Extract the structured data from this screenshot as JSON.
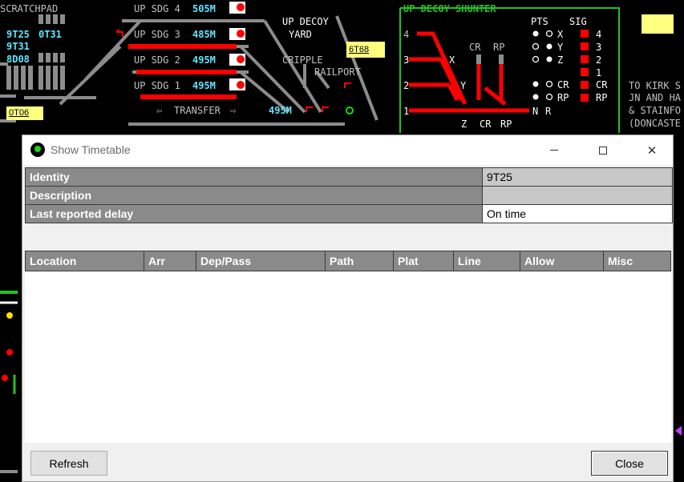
{
  "panel": {
    "scratchpad_label": "SCRATCHPAD",
    "scratch_entries": [
      "9T25",
      "0T31",
      "9T31",
      "8D08"
    ],
    "scratch_box": "0T06",
    "sidings": [
      {
        "label": "UP SDG 4",
        "length": "505M"
      },
      {
        "label": "UP SDG 3",
        "length": "485M"
      },
      {
        "label": "UP SDG 2",
        "length": "495M"
      },
      {
        "label": "UP SDG 1",
        "length": "495M"
      }
    ],
    "transfer_label": "TRANSFER",
    "transfer_length": "495M",
    "decoy_yard_line1": "UP DECOY",
    "decoy_yard_line2": "YARD",
    "cripple_label": "CRIPPLE",
    "railport_label": "RAILPORT",
    "headcode_box": "6T68",
    "shunter_title": "UP DECOY SHUNTER",
    "pts_label": "PTS",
    "sig_label": "SIG",
    "shunter_routes": [
      "4",
      "3",
      "2",
      "1"
    ],
    "shunter_letters": {
      "x": "X",
      "y": "Y",
      "z": "Z",
      "cr": "CR",
      "rp": "RP",
      "n": "N",
      "r": "R"
    },
    "pts_rows": [
      "X",
      "Y",
      "Z",
      "CR",
      "RP"
    ],
    "sig_rows": [
      "4",
      "3",
      "2",
      "1",
      "CR",
      "RP"
    ],
    "kirk_text": [
      "TO KIRK S",
      "JN AND HA",
      "& STAINFO",
      "(DONCASTE"
    ],
    "highlight_color": "#ffff80"
  },
  "dialog": {
    "title": "Show Timetable",
    "identity_label": "Identity",
    "identity_value": "9T25",
    "description_label": "Description",
    "description_value": "",
    "delay_label": "Last reported delay",
    "delay_value": "On time",
    "columns": [
      "Location",
      "Arr",
      "Dep/Pass",
      "Path",
      "Plat",
      "Line",
      "Allow",
      "Misc"
    ],
    "refresh_label": "Refresh",
    "close_label": "Close"
  }
}
